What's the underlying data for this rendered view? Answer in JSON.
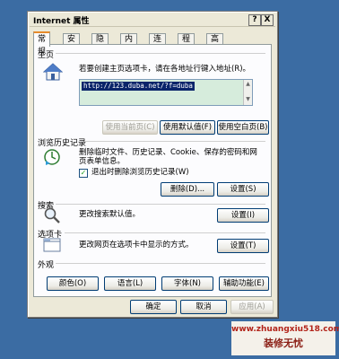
{
  "dialog": {
    "title": "Internet 属性",
    "help_glyph": "?",
    "close_glyph": "X"
  },
  "tabs": [
    {
      "label": "常规",
      "active": true
    },
    {
      "label": "安全"
    },
    {
      "label": "隐私"
    },
    {
      "label": "内容"
    },
    {
      "label": "连接"
    },
    {
      "label": "程序"
    },
    {
      "label": "高级"
    }
  ],
  "home": {
    "group_label": "主页",
    "description": "若要创建主页选项卡，请在各地址行键入地址(R)。",
    "url": "http://123.duba.net/?f=duba",
    "buttons": {
      "use_current": "使用当前页(C)",
      "use_default": "使用默认值(F)",
      "use_blank": "使用空白页(B)"
    }
  },
  "history": {
    "group_label": "浏览历史记录",
    "description": "删除临时文件、历史记录、Cookie、保存的密码和网页表单信息。",
    "checkbox_label": "退出时删除浏览历史记录(W)",
    "checkbox_mark": "✓",
    "buttons": {
      "delete": "删除(D)...",
      "settings": "设置(S)"
    }
  },
  "search": {
    "group_label": "搜索",
    "description": "更改搜索默认值。",
    "settings": "设置(I)"
  },
  "tabs_section": {
    "group_label": "选项卡",
    "description": "更改网页在选项卡中显示的方式。",
    "settings": "设置(T)"
  },
  "appearance": {
    "group_label": "外观",
    "buttons": {
      "colors": "颜色(O)",
      "languages": "语言(L)",
      "fonts": "字体(N)",
      "accessibility": "辅助功能(E)"
    }
  },
  "footer": {
    "ok": "确定",
    "cancel": "取消",
    "apply": "应用(A)"
  },
  "watermark": {
    "url": "www.zhuangxiu518.com",
    "name": "装修无忧"
  },
  "colors": {
    "desktop": "#3b6ca3",
    "dialog": "#ece9d8",
    "tab_accent": "#e68b2c",
    "url_bg": "#d6ecdc",
    "selection": "#0a246a"
  }
}
